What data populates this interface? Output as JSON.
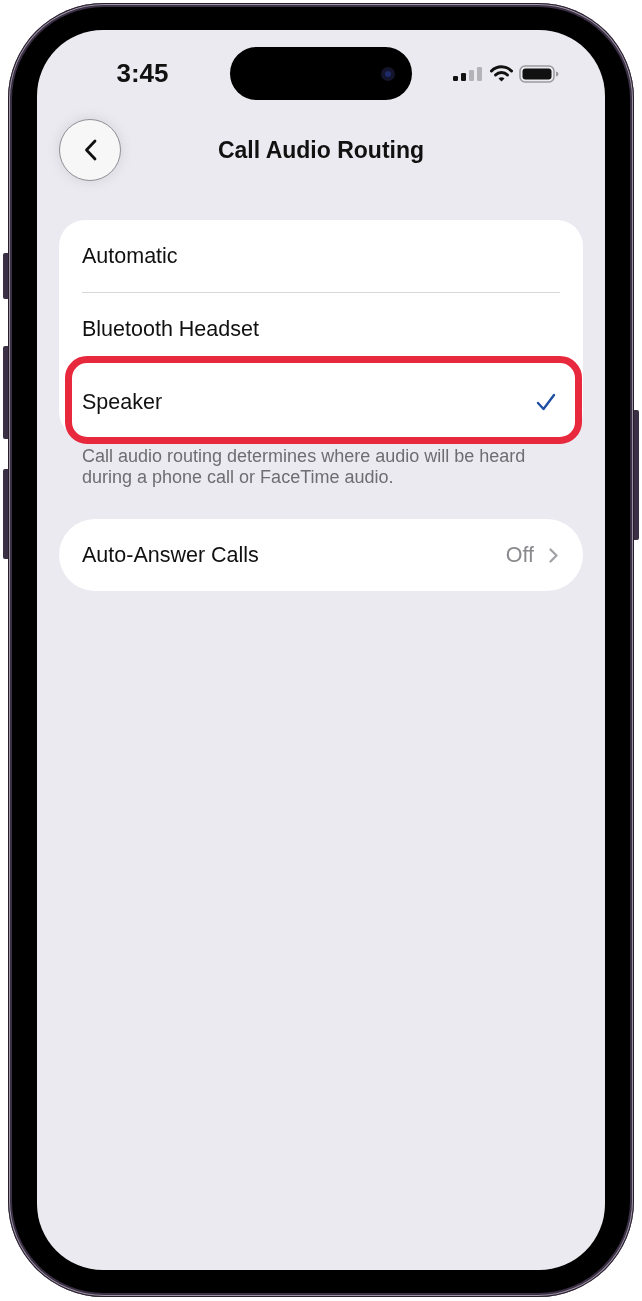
{
  "status_bar": {
    "time": "3:45"
  },
  "nav": {
    "title": "Call Audio Routing"
  },
  "routing_options": [
    {
      "label": "Automatic",
      "selected": false,
      "highlighted": false
    },
    {
      "label": "Bluetooth Headset",
      "selected": false,
      "highlighted": false
    },
    {
      "label": "Speaker",
      "selected": true,
      "highlighted": true
    }
  ],
  "routing_footer": "Call audio routing determines where audio will be heard during a phone call or FaceTime audio.",
  "auto_answer": {
    "label": "Auto-Answer Calls",
    "value": "Off"
  }
}
